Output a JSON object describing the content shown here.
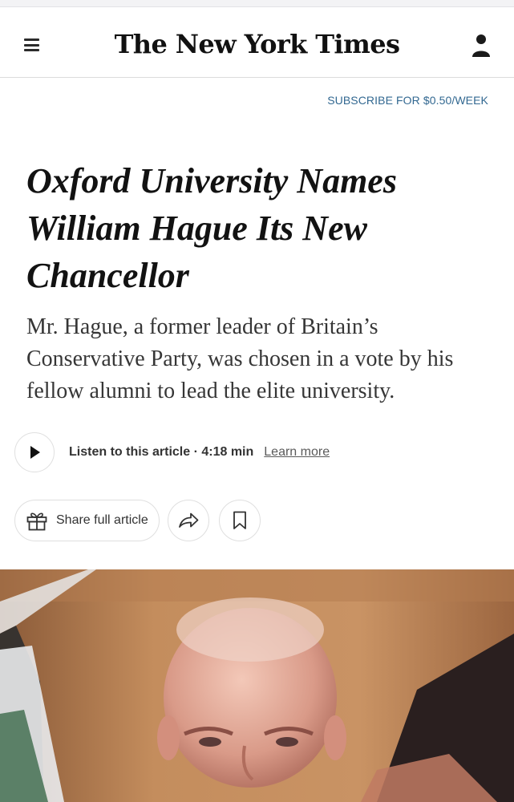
{
  "header": {
    "logo_text": "The New York Times",
    "subscribe_label": "SUBSCRIBE FOR $0.50/WEEK"
  },
  "article": {
    "headline": "Oxford University Names William Hague Its New Chancellor",
    "summary": "Mr. Hague, a former leader of Britain’s Conservative Party, was chosen in a vote by his fellow alumni to lead the elite university.",
    "listen_label": "Listen to this article · 4:18 min",
    "learn_more_label": "Learn more",
    "share_label": "Share full article"
  },
  "icons": {
    "menu": "hamburger-menu-icon",
    "account": "user-account-icon",
    "play": "play-icon",
    "gift": "gift-icon",
    "share": "share-arrow-icon",
    "save": "bookmark-icon"
  },
  "colors": {
    "subscribe_link": "#326891",
    "text": "#121212",
    "button_border": "#dfdfdf"
  }
}
